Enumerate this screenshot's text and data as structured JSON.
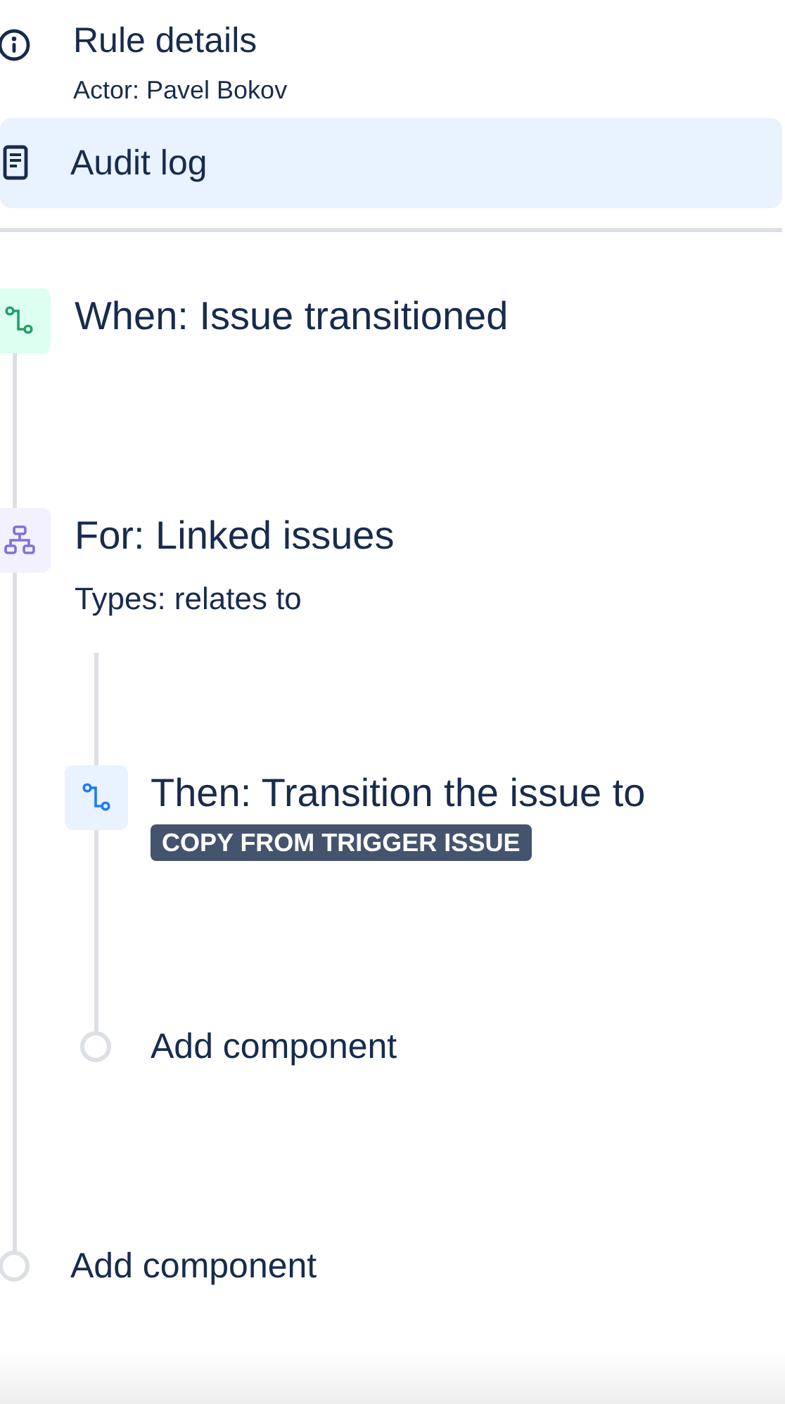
{
  "nav": [
    {
      "label": "Rule details",
      "subtitle": "Actor: Pavel Bokov",
      "kind": "details",
      "selected": false
    },
    {
      "label": "Audit log",
      "kind": "audit",
      "selected": true
    }
  ],
  "components": [
    {
      "kind": "trigger",
      "title": "When: Issue transitioned"
    },
    {
      "kind": "branch",
      "title": "For: Linked issues",
      "subtitle": "Types: relates to",
      "children": [
        {
          "kind": "action",
          "title": "Then: Transition the issue to",
          "badge": "COPY FROM TRIGGER ISSUE"
        },
        {
          "kind": "add",
          "title": "Add component"
        }
      ]
    },
    {
      "kind": "add",
      "title": "Add component"
    }
  ]
}
